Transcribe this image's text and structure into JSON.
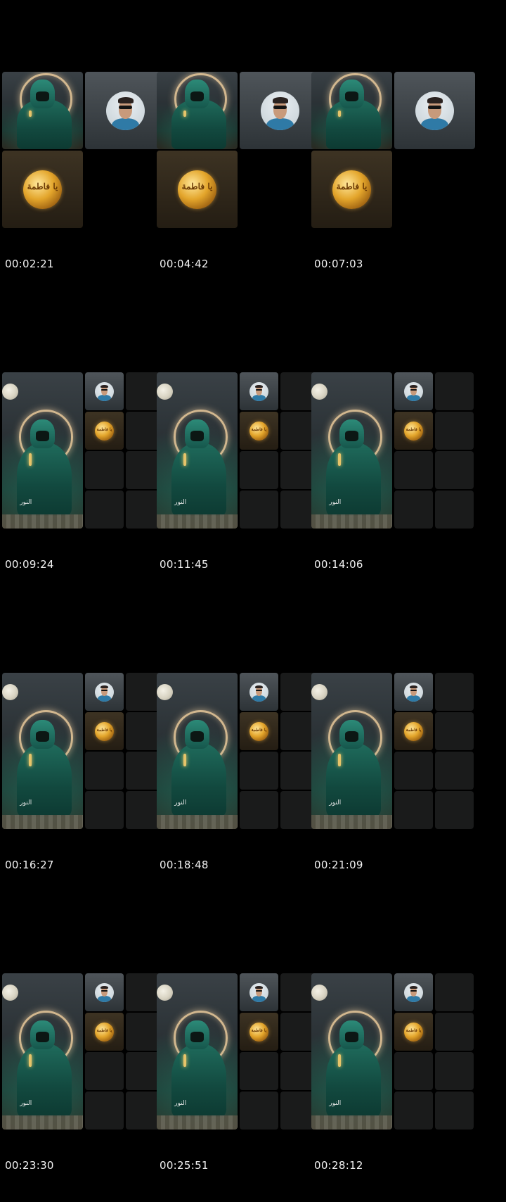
{
  "timestamps": [
    "00:02:21",
    "00:04:42",
    "00:07:03",
    "00:09:24",
    "00:11:45",
    "00:14:06",
    "00:16:27",
    "00:18:48",
    "00:21:09",
    "00:23:30",
    "00:25:51",
    "00:28:12"
  ],
  "scene_caption": "النور",
  "emblem_text": "يا فاطمة",
  "icons": {
    "scene": "woman-praying-thumbnail",
    "avatar": "user-avatar",
    "emblem": "gold-emblem"
  },
  "colors": {
    "background": "#000000",
    "empty_tile": "#1a1b1b",
    "timestamp": "#f2f2f2"
  }
}
